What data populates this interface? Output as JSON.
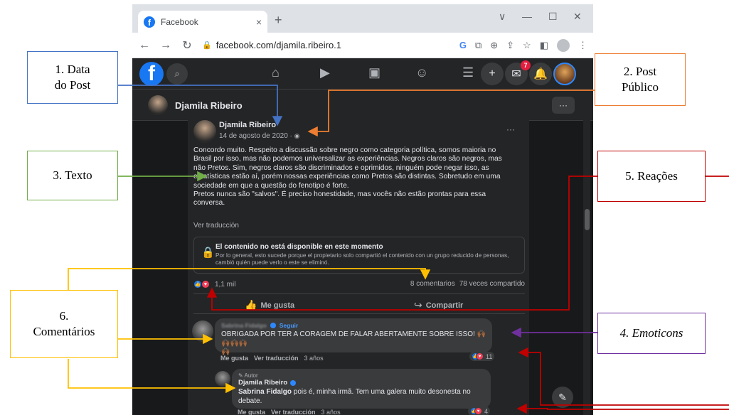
{
  "browser": {
    "tab_title": "Facebook",
    "tab_close": "×",
    "new_tab": "+",
    "url": "facebook.com/djamila.ribeiro.1",
    "window_controls": [
      "∨",
      "—",
      "☐",
      "✕"
    ]
  },
  "facebook": {
    "logo": "f",
    "messenger_badge": "7",
    "page_header": {
      "name": "Djamila Ribeiro",
      "more": "···"
    },
    "post": {
      "author": "Djamila Ribeiro",
      "date": "14 de agosto de 2020",
      "date_separator": " · ",
      "text_lines": [
        "Concordo muito. Respeito a discussão sobre negro como categoria política, somos maioria no",
        "Brasil por isso, mas não podemos universalizar as experiências. Negros claros são negros, mas",
        "não Pretos. Sim, negros claros são discriminados e oprimidos, ninguém pode negar isso, as",
        "estatísticas estão aí, porém nossas experiências como Pretos são distintas. Sobretudo em uma",
        "sociedade em que a questão do fenotipo é forte.",
        "Pretos nunca são \"salvos\". É preciso honestidade, mas vocês não estão prontas para essa",
        "conversa."
      ],
      "see_translation": "Ver traducción",
      "unavailable": {
        "title": "El contenido no está disponible en este momento",
        "description": "Por lo general, esto sucede porque el propietario solo compartió el contenido con un grupo reducido de personas, cambió quién puede verlo o este se eliminó."
      },
      "reactions_count": "1,1 mil",
      "comments_count": "8 comentarios",
      "shares_count": "78 veces compartido",
      "like_action": "Me gusta",
      "share_action": "Compartir"
    },
    "comments": [
      {
        "name": "Sabrina Fidalgo",
        "follow": "Seguir",
        "text": "OBRIGADA POR TER A CORAGEM DE FALAR ABERTAMENTE SOBRE ISSO!",
        "emojis": "🙌🏾🙌🏾🙌🏾🙌🏾",
        "emoji_tail": "🙌🏾",
        "like": "Me gusta",
        "translate": "Ver traducción",
        "time": "3 años",
        "reaction_count": "11"
      }
    ],
    "reply": {
      "author_tag": "Autor",
      "author": "Djamila Ribeiro",
      "mention": "Sabrina Fidalgo",
      "text_line1": " pois é, minha irmã. Tem uma galera muito desonesta no",
      "text_line2": "debate.",
      "like": "Me gusta",
      "translate": "Ver traducción",
      "time": "3 años",
      "reaction_count": "4"
    }
  },
  "annotations": {
    "data_post": [
      "1. Data",
      "do Post"
    ],
    "post_publico": [
      "2. Post",
      "Público"
    ],
    "texto": "3. Texto",
    "emoticons": "4. Emoticons",
    "reacoes": "5. Reações",
    "comentarios": [
      "6.",
      "Comentários"
    ],
    "colors": {
      "data_post": "#4472c4",
      "post_publico": "#ed7d31",
      "texto": "#70ad47",
      "emoticons": "#7030a0",
      "reacoes": "#c00000",
      "comentarios": "#ffc000"
    }
  }
}
